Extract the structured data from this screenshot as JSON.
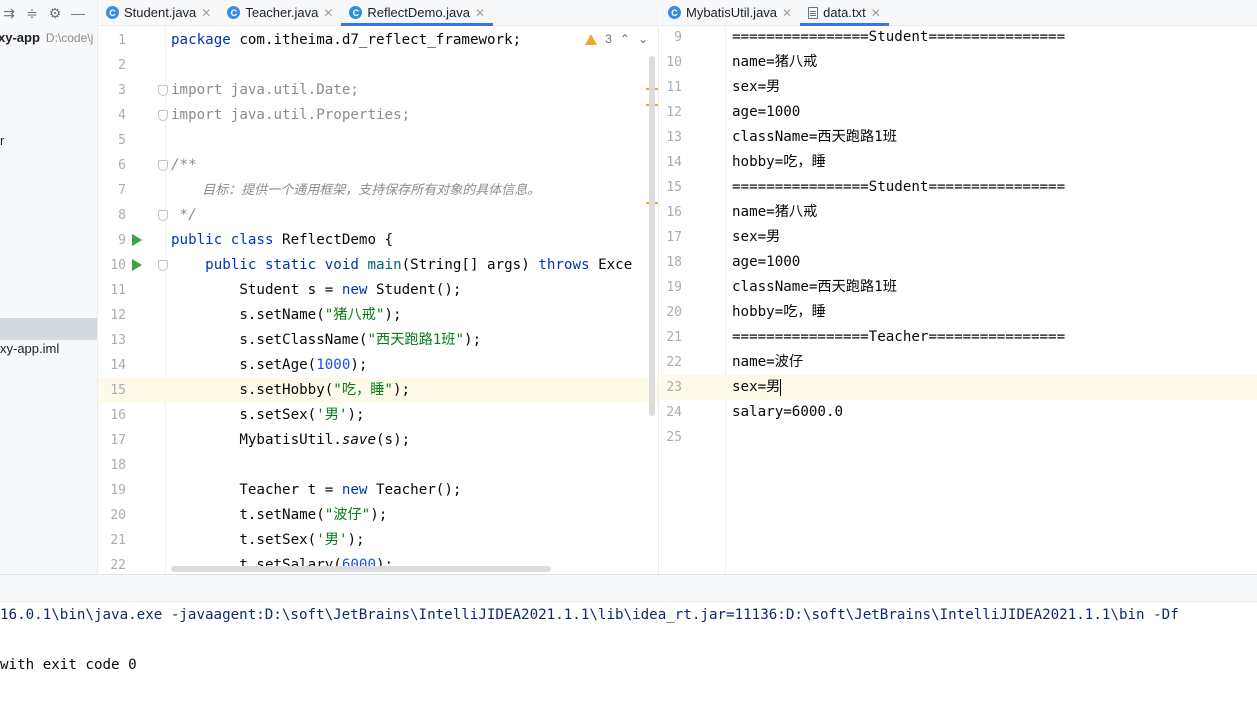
{
  "project": {
    "root_name": "xy-app",
    "root_path": "D:\\code\\j",
    "item_r": "r",
    "iml_file": "xy-app.iml"
  },
  "tabs_left": [
    {
      "label": "Student.java"
    },
    {
      "label": "Teacher.java"
    },
    {
      "label": "ReflectDemo.java"
    }
  ],
  "tabs_right": [
    {
      "label": "MybatisUtil.java"
    },
    {
      "label": "data.txt"
    }
  ],
  "inspection": {
    "warnings": "3"
  },
  "left_editor": {
    "lines": [
      {
        "n": "1"
      },
      {
        "n": "2"
      },
      {
        "n": "3"
      },
      {
        "n": "4"
      },
      {
        "n": "5"
      },
      {
        "n": "6"
      },
      {
        "n": "7"
      },
      {
        "n": "8"
      },
      {
        "n": "9"
      },
      {
        "n": "10"
      },
      {
        "n": "11"
      },
      {
        "n": "12"
      },
      {
        "n": "13"
      },
      {
        "n": "14"
      },
      {
        "n": "15"
      },
      {
        "n": "16"
      },
      {
        "n": "17"
      },
      {
        "n": "18"
      },
      {
        "n": "19"
      },
      {
        "n": "20"
      },
      {
        "n": "21"
      },
      {
        "n": "22"
      }
    ],
    "code": {
      "l1_kw": "package",
      "l1_rest": " com.itheima.d7_reflect_framework;",
      "l3_kw": "import",
      "l3_rest": " java.util.Date;",
      "l4_kw": "import",
      "l4_rest": " java.util.Properties;",
      "l6": "/**",
      "l7": "    目标：提供一个通用框架，支持保存所有对象的具体信息。",
      "l8": " */",
      "l9_kw": "public class",
      "l9_rest": " ReflectDemo {",
      "l10_kw": "    public static void",
      "l10_meth": " main",
      "l10_rest": "(String[] args) ",
      "l10_throws": "throws",
      "l10_tail": " Exce",
      "l11_a": "        Student s = ",
      "l11_kw": "new",
      "l11_b": " Student();",
      "l12_a": "        s.setName(",
      "l12_str": "\"猪八戒\"",
      "l12_b": ");",
      "l13_a": "        s.setClassName(",
      "l13_str": "\"西天跑路1班\"",
      "l13_b": ");",
      "l14_a": "        s.setAge(",
      "l14_num": "1000",
      "l14_b": ");",
      "l15_a": "        s.setHobby(",
      "l15_str": "\"吃，睡\"",
      "l15_b": ");",
      "l16_a": "        s.setSex(",
      "l16_str": "'男'",
      "l16_b": ");",
      "l17_a": "        MybatisUtil.",
      "l17_it": "save",
      "l17_b": "(s);",
      "l19_a": "        Teacher t = ",
      "l19_kw": "new",
      "l19_b": " Teacher();",
      "l20_a": "        t.setName(",
      "l20_str": "\"波仔\"",
      "l20_b": ");",
      "l21_a": "        t.setSex(",
      "l21_str": "'男'",
      "l21_b": ");",
      "l22_a": "        t.setSalary(",
      "l22_num": "6000",
      "l22_b": ");"
    }
  },
  "right_editor": {
    "lines": [
      {
        "n": "9",
        "text": "================Student================"
      },
      {
        "n": "10",
        "text": "name=猪八戒"
      },
      {
        "n": "11",
        "text": "sex=男"
      },
      {
        "n": "12",
        "text": "age=1000"
      },
      {
        "n": "13",
        "text": "className=西天跑路1班"
      },
      {
        "n": "14",
        "text": "hobby=吃，睡"
      },
      {
        "n": "15",
        "text": "================Student================"
      },
      {
        "n": "16",
        "text": "name=猪八戒"
      },
      {
        "n": "17",
        "text": "sex=男"
      },
      {
        "n": "18",
        "text": "age=1000"
      },
      {
        "n": "19",
        "text": "className=西天跑路1班"
      },
      {
        "n": "20",
        "text": "hobby=吃，睡"
      },
      {
        "n": "21",
        "text": "================Teacher================"
      },
      {
        "n": "22",
        "text": "name=波仔"
      },
      {
        "n": "23",
        "text": "sex=男"
      },
      {
        "n": "24",
        "text": "salary=6000.0"
      },
      {
        "n": "25",
        "text": ""
      }
    ]
  },
  "console": {
    "command": "16.0.1\\bin\\java.exe -javaagent:D:\\soft\\JetBrains\\IntelliJIDEA2021.1.1\\lib\\idea_rt.jar=11136:D:\\soft\\JetBrains\\IntelliJIDEA2021.1.1\\bin -Df",
    "exit": "with exit code 0"
  }
}
